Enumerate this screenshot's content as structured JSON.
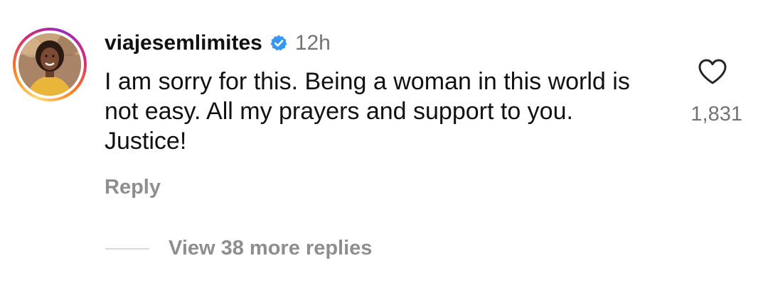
{
  "comment": {
    "username": "viajesemlimites",
    "verified_icon": "verified-badge-icon",
    "time": "12h",
    "text": "I am sorry for this. Being a woman in this world is not easy. All my prayers and support to you. Justice!",
    "reply_label": "Reply",
    "like_icon": "heart-icon",
    "like_count": "1,831",
    "view_replies_label": "View 38 more replies"
  },
  "colors": {
    "text": "#111111",
    "secondary": "#737373",
    "muted": "#8e8e8e",
    "verified": "#3897f0",
    "divider": "#d9d9d9"
  }
}
